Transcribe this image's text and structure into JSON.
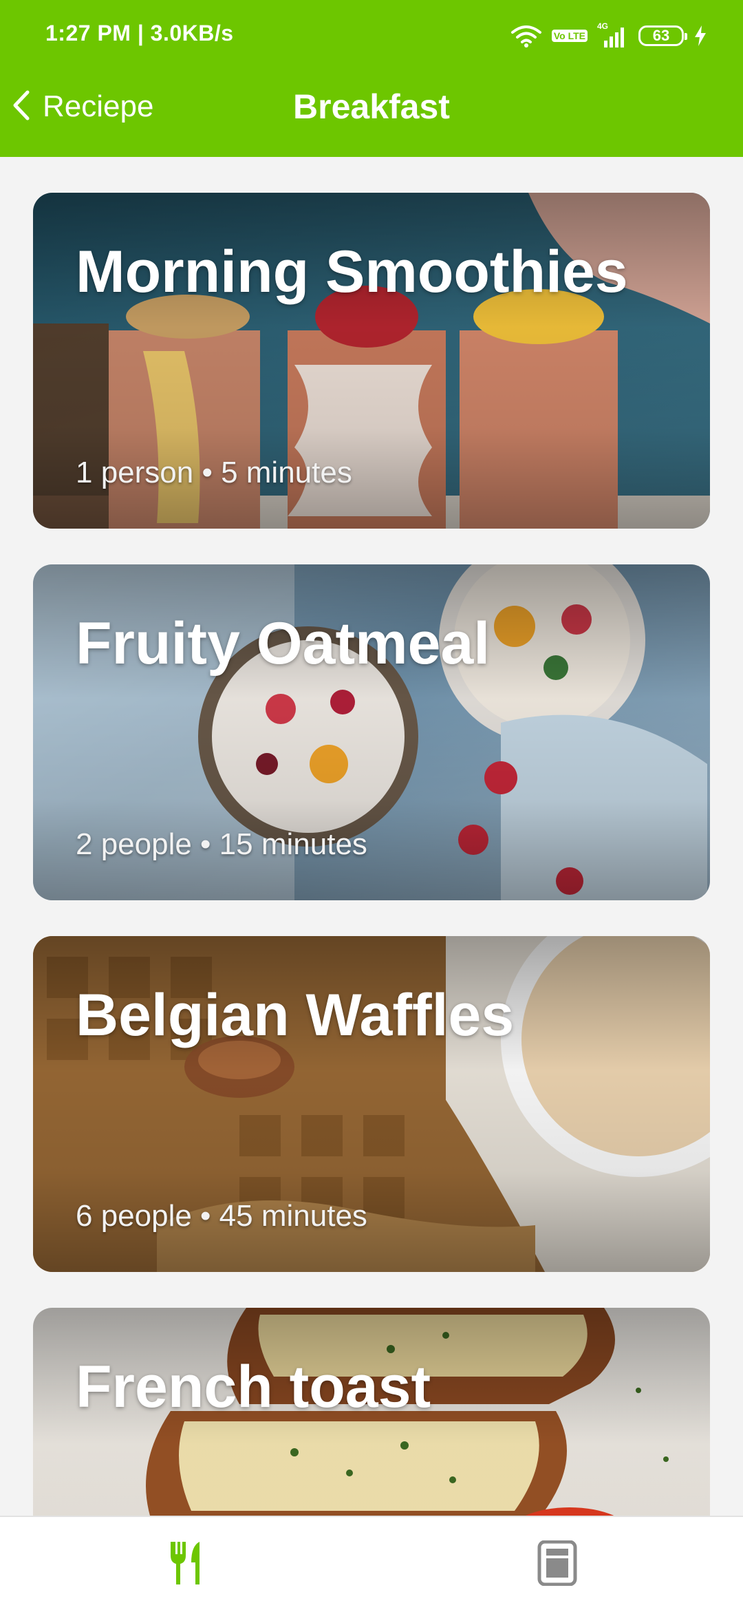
{
  "status_bar": {
    "time": "1:27 PM | 3.0KB/s",
    "network_label": "4G",
    "volte_label": "Vo LTE",
    "battery_level": "63"
  },
  "app_bar": {
    "back_label": "Reciepe",
    "title": "Breakfast"
  },
  "recipes": [
    {
      "title": "Morning Smoothies",
      "meta": "1 person • 5 minutes"
    },
    {
      "title": "Fruity Oatmeal",
      "meta": "2 people • 15 minutes"
    },
    {
      "title": "Belgian Waffles",
      "meta": "6 people • 45 minutes"
    },
    {
      "title": "French toast",
      "meta": ""
    }
  ],
  "bottom_nav": {
    "items": [
      {
        "icon": "cutlery-icon",
        "active": true
      },
      {
        "icon": "tablet-icon",
        "active": false
      }
    ]
  },
  "colors": {
    "accent": "#6dc600",
    "inactive_icon": "#8a8a8a"
  }
}
